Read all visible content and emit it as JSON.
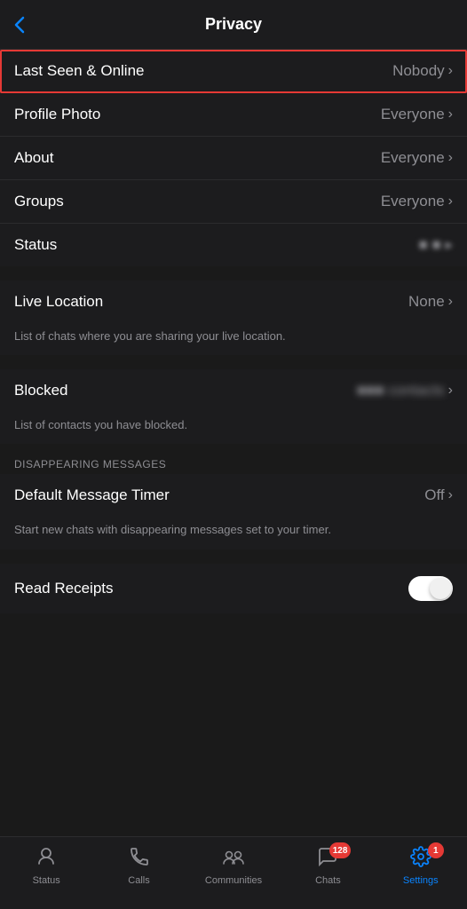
{
  "header": {
    "title": "Privacy",
    "back_label": "‹"
  },
  "settings": {
    "group1": {
      "rows": [
        {
          "id": "last-seen",
          "label": "Last Seen & Online",
          "value": "Nobody",
          "highlighted": true
        },
        {
          "id": "profile-photo",
          "label": "Profile Photo",
          "value": "Everyone",
          "highlighted": false
        },
        {
          "id": "about",
          "label": "About",
          "value": "Everyone",
          "highlighted": false
        },
        {
          "id": "groups",
          "label": "Groups",
          "value": "Everyone",
          "highlighted": false
        },
        {
          "id": "status",
          "label": "Status",
          "value": "••• ■ ■ •",
          "highlighted": false,
          "blurred": true
        }
      ]
    },
    "group2": {
      "rows": [
        {
          "id": "live-location",
          "label": "Live Location",
          "value": "None",
          "sub_text": "List of chats where you are sharing your live location."
        }
      ]
    },
    "group3": {
      "rows": [
        {
          "id": "blocked",
          "label": "Blocked",
          "value": "••• contacts",
          "blurred": true,
          "sub_text": "List of contacts you have blocked."
        }
      ]
    },
    "disappearing_messages": {
      "section_label": "DISAPPEARING MESSAGES",
      "rows": [
        {
          "id": "default-message-timer",
          "label": "Default Message Timer",
          "value": "Off",
          "sub_text": "Start new chats with disappearing messages set to your timer."
        }
      ]
    },
    "read_receipts": {
      "label": "Read Receipts",
      "toggle_on": true
    }
  },
  "tab_bar": {
    "items": [
      {
        "id": "status",
        "label": "Status",
        "icon": "⬡",
        "active": false,
        "badge": null
      },
      {
        "id": "calls",
        "label": "Calls",
        "icon": "✆",
        "active": false,
        "badge": null
      },
      {
        "id": "communities",
        "label": "Communities",
        "icon": "⊞",
        "active": false,
        "badge": null
      },
      {
        "id": "chats",
        "label": "Chats",
        "icon": "💬",
        "active": false,
        "badge": "128"
      },
      {
        "id": "settings",
        "label": "Settings",
        "icon": "⚙",
        "active": true,
        "badge": "1"
      }
    ]
  }
}
